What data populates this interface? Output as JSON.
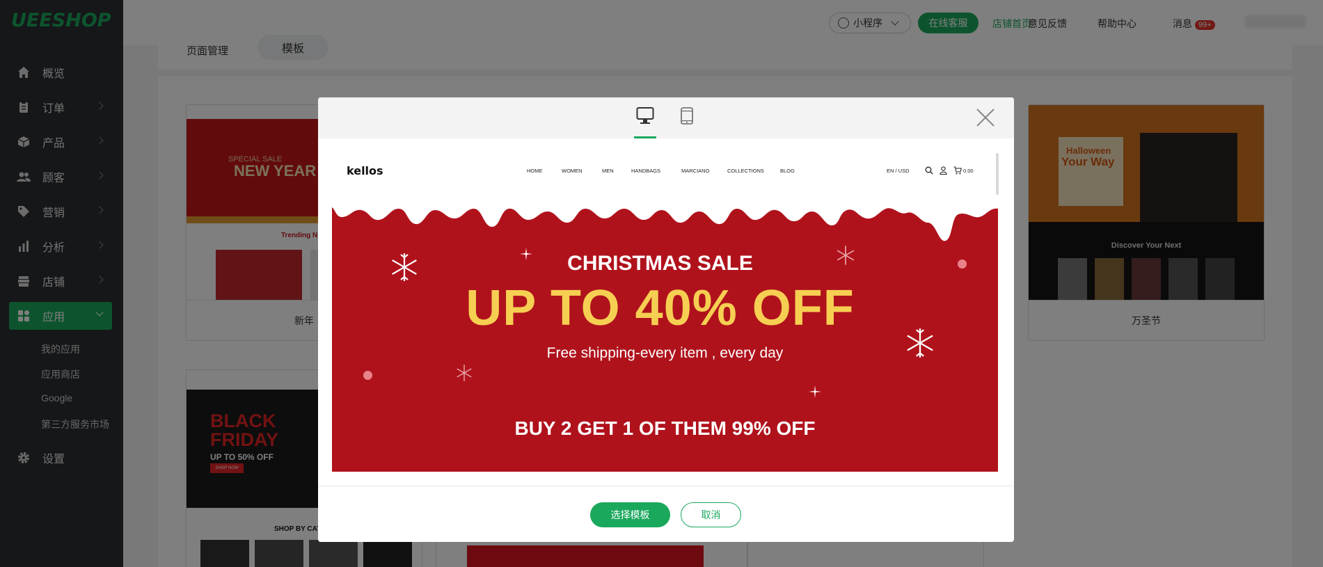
{
  "brand": {
    "logo": "UEESHOP",
    "accent": "#1aa85c"
  },
  "sidebar": {
    "items": [
      {
        "label": "概览",
        "icon": "home-icon"
      },
      {
        "label": "订单",
        "icon": "clipboard-icon"
      },
      {
        "label": "产品",
        "icon": "box-icon"
      },
      {
        "label": "顾客",
        "icon": "users-icon"
      },
      {
        "label": "营销",
        "icon": "tag-icon"
      },
      {
        "label": "分析",
        "icon": "bar-chart-icon"
      },
      {
        "label": "店铺",
        "icon": "store-icon"
      },
      {
        "label": "应用",
        "icon": "apps-icon"
      },
      {
        "label": "设置",
        "icon": "gear-icon"
      }
    ],
    "apps_submenu": [
      "我的应用",
      "应用商店",
      "Google",
      "第三方服务市场"
    ]
  },
  "topbar": {
    "mini_program": "小程序",
    "online_service": "在线客服",
    "shop_home": "店铺首页",
    "feedback": "意见反馈",
    "help": "帮助中心",
    "messages": "消息",
    "messages_badge": "99+"
  },
  "background": {
    "tabs": [
      "页面管理",
      "模板"
    ],
    "cards": [
      {
        "name": "新年",
        "thumb_text": "NEW YEAR",
        "thumb_sub": "SPECIAL SALE",
        "thumb_caption": "Trending N"
      },
      {
        "name": "万圣节",
        "thumb_text": "Your Way",
        "thumb_title": "Halloween",
        "thumb_caption": "Discover Your Next"
      },
      {
        "name": "",
        "thumb_text": "BLACK FRIDAY",
        "thumb_sub": "UP TO 50% OFF",
        "thumb_btn": "SHOP NOW",
        "thumb_caption": "SHOP BY CATE"
      }
    ]
  },
  "modal": {
    "devices": {
      "desktop": "desktop-icon",
      "mobile": "mobile-icon"
    },
    "preview": {
      "site_logo": "kellos",
      "nav": [
        "HOME",
        "WOMEN",
        "MEN",
        "HANDBAGS",
        "MARCIANO",
        "COLLECTIONS",
        "BLOG"
      ],
      "lang": "EN / USD",
      "cart_total": "0.00",
      "banner": {
        "line1": "CHRISTMAS SALE",
        "line2": "UP TO 40% OFF",
        "line3": "Free shipping-every item , every day",
        "line4": "BUY 2 GET 1 OF THEM 99% OFF",
        "bg_color": "#b0121c",
        "highlight_color": "#f6cf52"
      }
    },
    "select_button": "选择模板",
    "cancel_button": "取消"
  }
}
